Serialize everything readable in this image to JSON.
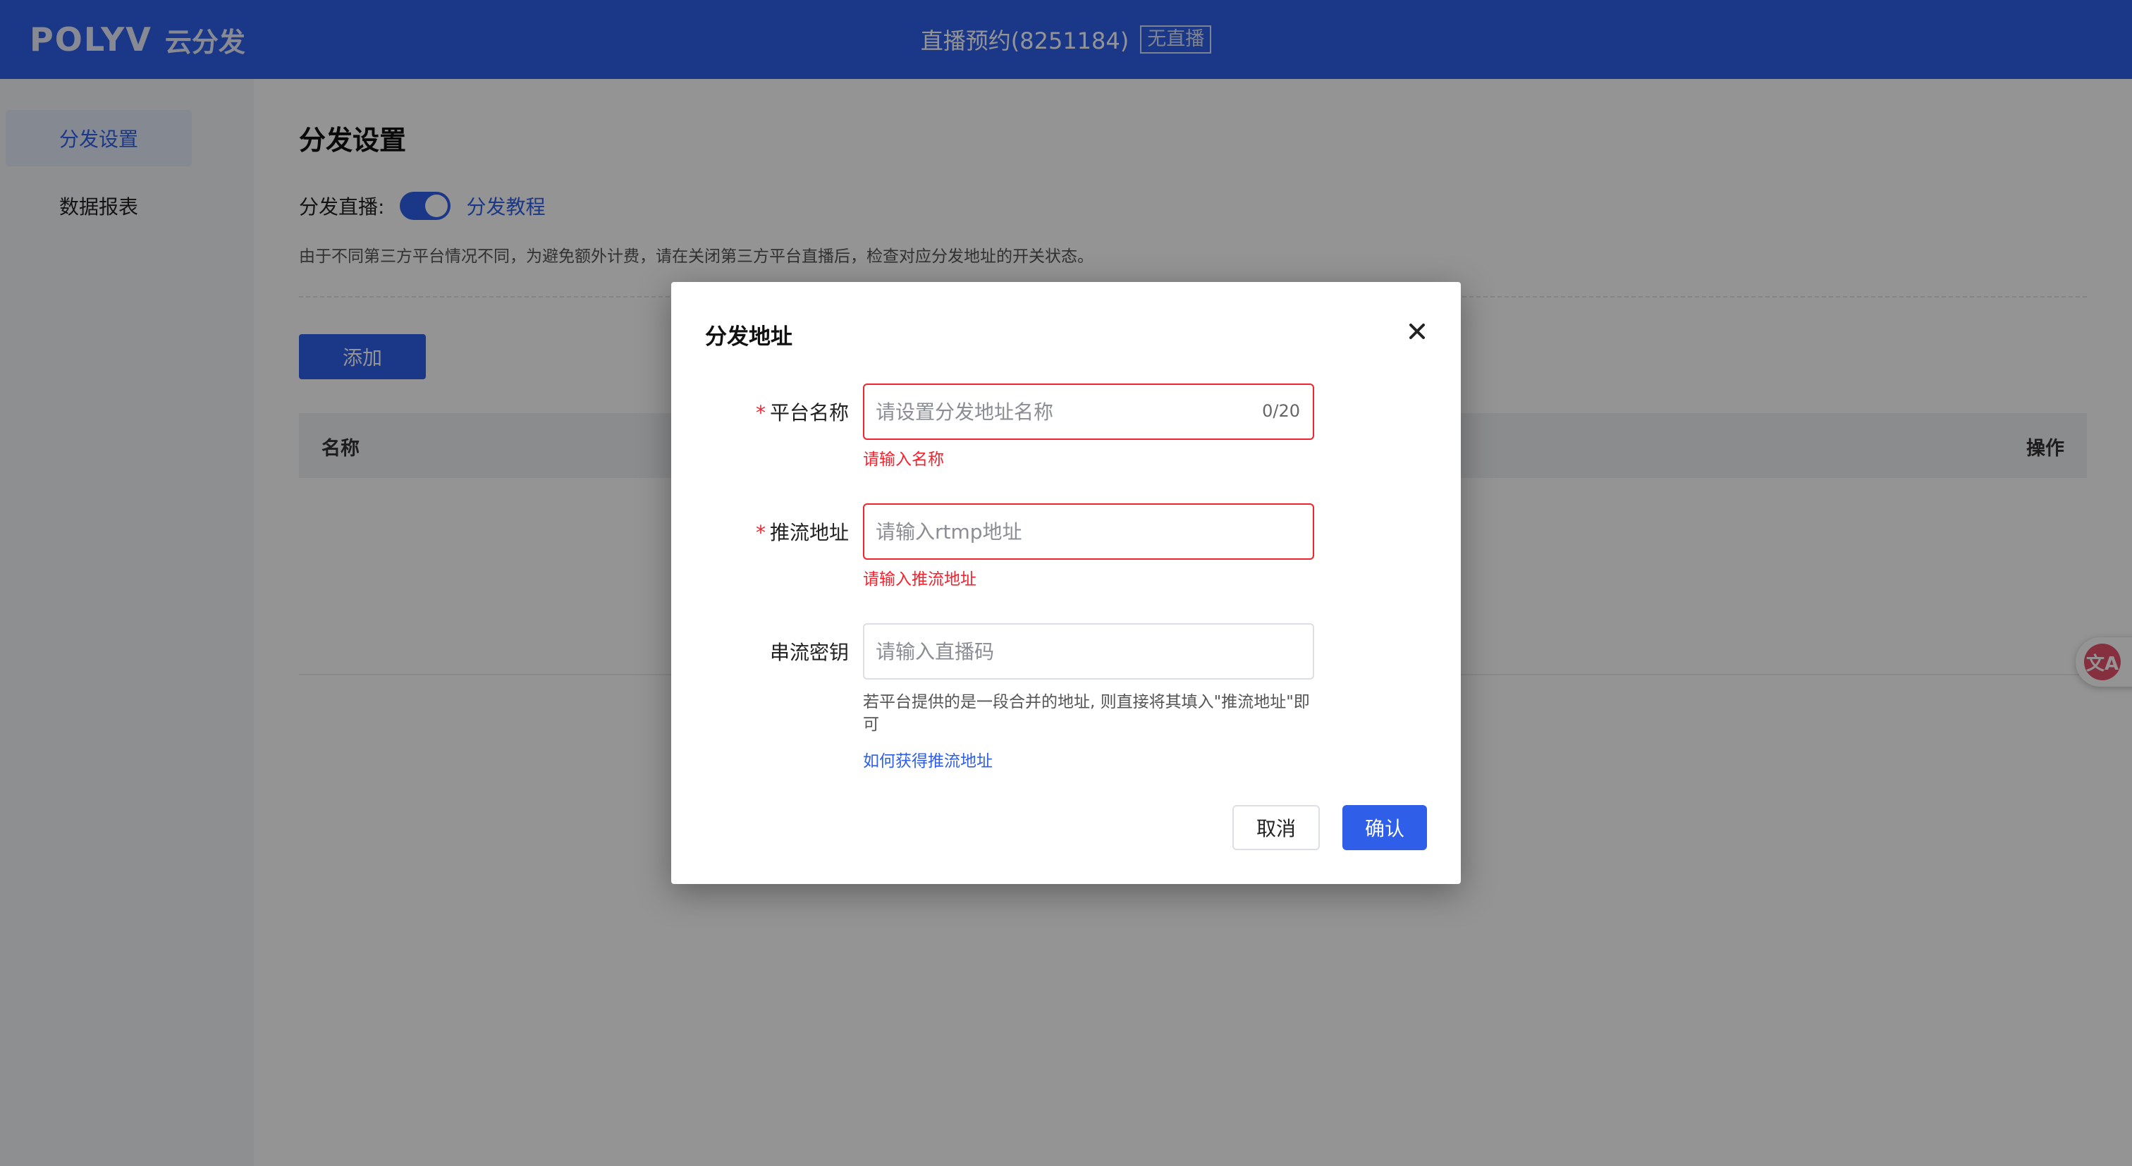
{
  "header": {
    "logo_mark": "POLYV",
    "logo_text": "云分发",
    "title": "直播预约(8251184)",
    "status_badge": "无直播"
  },
  "sidebar": {
    "items": [
      {
        "label": "分发设置",
        "active": true
      },
      {
        "label": "数据报表",
        "active": false
      }
    ]
  },
  "main": {
    "page_title": "分发设置",
    "switch_label": "分发直播:",
    "switch_on": true,
    "tutorial_link": "分发教程",
    "notice": "由于不同第三方平台情况不同，为避免额外计费，请在关闭第三方平台直播后，检查对应分发地址的开关状态。",
    "add_button": "添加",
    "table": {
      "columns": [
        "名称",
        "操作"
      ]
    }
  },
  "floating_tool": {
    "icon": "translate-icon",
    "glyph": "文A"
  },
  "dialog": {
    "title": "分发地址",
    "close_icon": "close-icon",
    "fields": [
      {
        "label": "平台名称",
        "required": true,
        "placeholder": "请设置分发地址名称",
        "value": "",
        "counter": "0/20",
        "error": "请输入名称"
      },
      {
        "label": "推流地址",
        "required": true,
        "placeholder": "请输入rtmp地址",
        "value": "",
        "error": "请输入推流地址"
      },
      {
        "label": "串流密钥",
        "required": false,
        "placeholder": "请输入直播码",
        "value": ""
      }
    ],
    "help_text": "若平台提供的是一段合并的地址, 则直接将其填入\"推流地址\"即可",
    "help_link": "如何获得推流地址",
    "cancel_button": "取消",
    "confirm_button": "确认"
  },
  "colors": {
    "brand": "#2f5fe8",
    "error": "#f5222d",
    "overlay": "rgba(0,0,0,0.42)"
  }
}
